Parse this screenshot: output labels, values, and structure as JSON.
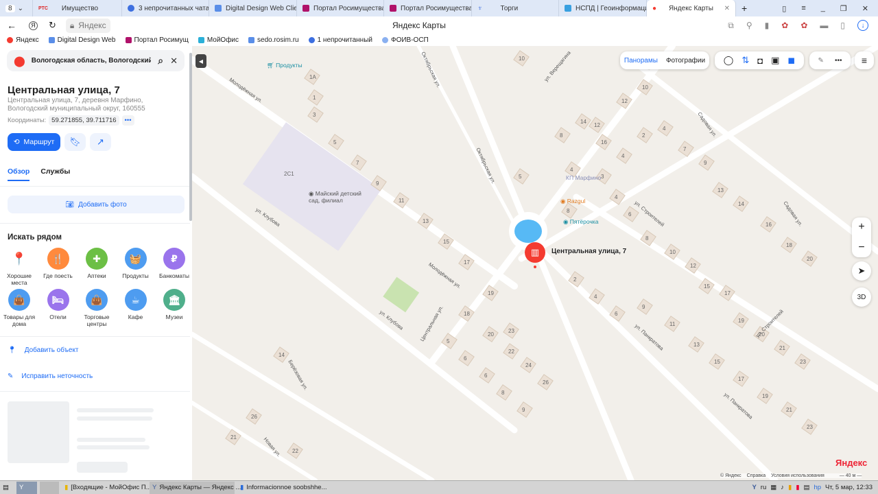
{
  "browser": {
    "tab_count": "8",
    "tabs": [
      {
        "label": "Имущество",
        "favicon": "РТС"
      },
      {
        "label": "3 непрочитанных чата"
      },
      {
        "label": "Digital Design Web Client"
      },
      {
        "label": "Портал Росимущества"
      },
      {
        "label": "Портал Росимущества"
      },
      {
        "label": "Торги"
      },
      {
        "label": "НСПД | Геоинформационная"
      },
      {
        "label": "Яндекс Карты"
      }
    ],
    "address_host": "Яндекс",
    "page_title": "Яндекс Карты",
    "bookmarks": [
      "Яндекс",
      "Digital Design Web",
      "Портал Росимущ",
      "МойОфис",
      "sedo.rosim.ru",
      "1 непрочитанный",
      "ФОИВ-ОСП"
    ]
  },
  "panel": {
    "search_value": "Вологодская область, Вологодский р",
    "title": "Центральная улица, 7",
    "subtitle": "Центральная улица, 7, деревня Марфино, Вологодский муниципальный округ, 160555",
    "coords_label": "Координаты:",
    "coords_value": "59.271855, 39.711716",
    "route_label": "Маршрут",
    "tabs": [
      "Обзор",
      "Службы"
    ],
    "add_photo": "Добавить фото",
    "nearby_title": "Искать рядом",
    "categories": [
      {
        "label": "Хорошие места",
        "color": "#ffffff"
      },
      {
        "label": "Где поесть",
        "color": "#ff8a3d"
      },
      {
        "label": "Аптеки",
        "color": "#6cbf45"
      },
      {
        "label": "Продукты",
        "color": "#4e9cf0"
      },
      {
        "label": "Банкоматы",
        "color": "#9a74ec"
      },
      {
        "label": "Товары для дома",
        "color": "#4e9cf0"
      },
      {
        "label": "Отели",
        "color": "#9a74ec"
      },
      {
        "label": "Торговые центры",
        "color": "#4e9cf0"
      },
      {
        "label": "Кафе",
        "color": "#4e9cf0"
      },
      {
        "label": "Музеи",
        "color": "#4faf8b"
      }
    ],
    "add_object": "Добавить объект",
    "fix_error": "Исправить неточность"
  },
  "map": {
    "layers": {
      "panoramas": "Панорамы",
      "photos": "Фотографии"
    },
    "zoom_3d": "3D",
    "marker_label": "Центральная улица, 7",
    "pois": [
      "Продукты",
      "Майский детский сад, филиал",
      "КП Марфино",
      "Razgul",
      "Пятёрочка"
    ],
    "streets": [
      "Молодёжная ул.",
      "ул. Клубова",
      "Октябрьская ул.",
      "ул. Верещагина",
      "Садовая ул.",
      "ул. Строителей",
      "ул. Панкратова",
      "Центральная ул.",
      "Берёзовая ул.",
      "Новая ул."
    ],
    "building_2c1": "2С1",
    "brand": "Яндекс",
    "footer": {
      "copyright": "© Яндекс",
      "help": "Справка",
      "terms": "Условия использования",
      "scale": "40 м"
    },
    "accent": "#1e6cf5",
    "marker_color": "#f43b30"
  },
  "taskbar": {
    "items": [
      "[Входящие - МойОфис П...",
      "Яндекс Карты — Яндекс ...",
      "Informacionnoe soobshhe..."
    ],
    "lang": "ru",
    "clock": "Чт, 5 мар, 12:33"
  }
}
